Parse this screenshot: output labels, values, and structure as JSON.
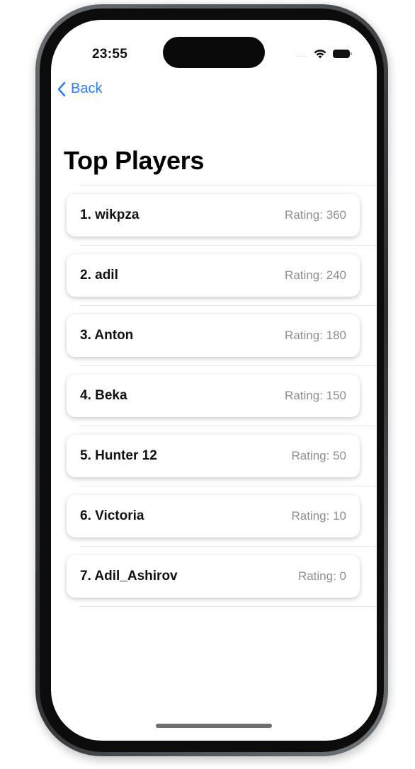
{
  "status_bar": {
    "time": "23:55",
    "signal_dots": "....",
    "icons": [
      "wifi-icon",
      "battery-icon"
    ]
  },
  "nav": {
    "back_label": "Back",
    "back_icon": "chevron-left-icon"
  },
  "page": {
    "title": "Top Players"
  },
  "players": [
    {
      "name": "1. wikpza",
      "rating": "Rating: 360"
    },
    {
      "name": "2. adil",
      "rating": "Rating: 240"
    },
    {
      "name": "3. Anton",
      "rating": "Rating: 180"
    },
    {
      "name": "4. Beka",
      "rating": "Rating: 150"
    },
    {
      "name": "5. Hunter 12",
      "rating": "Rating: 50"
    },
    {
      "name": "6. Victoria",
      "rating": "Rating: 10"
    },
    {
      "name": "7. Adil_Ashirov",
      "rating": "Rating: 0"
    }
  ],
  "colors": {
    "accent": "#2f7cf6",
    "text_primary": "#111111",
    "text_secondary": "#8e8e93",
    "separator": "#e6e6e6"
  }
}
